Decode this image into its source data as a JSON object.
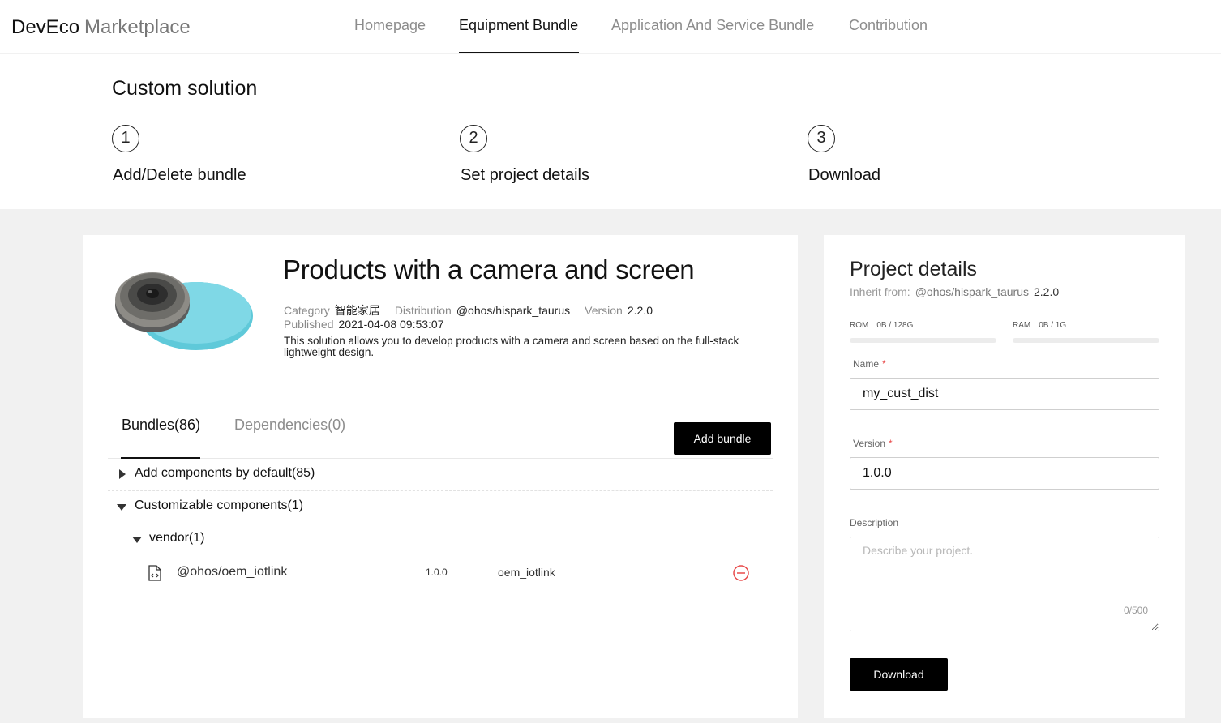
{
  "header": {
    "logo_main": "DevEco",
    "logo_sub": "Marketplace",
    "nav": [
      {
        "label": "Homepage"
      },
      {
        "label": "Equipment Bundle"
      },
      {
        "label": "Application And Service Bundle"
      },
      {
        "label": "Contribution"
      }
    ]
  },
  "steps": {
    "title": "Custom solution",
    "items": [
      {
        "number": "1",
        "label": "Add/Delete bundle"
      },
      {
        "number": "2",
        "label": "Set project details"
      },
      {
        "number": "3",
        "label": "Download"
      }
    ]
  },
  "product": {
    "title": "Products with a camera and screen",
    "category_label": "Category",
    "category_value": "智能家居",
    "distribution_label": "Distribution",
    "distribution_value": "@ohos/hispark_taurus",
    "version_label": "Version",
    "version_value": "2.2.0",
    "published_label": "Published",
    "published_value": "2021-04-08 09:53:07",
    "description": "This solution allows you to develop products with a camera and screen based on the full-stack lightweight design."
  },
  "tabs": {
    "bundles": "Bundles(86)",
    "dependencies": "Dependencies(0)",
    "add_bundle": "Add bundle"
  },
  "tree": {
    "default_group": "Add components by default(85)",
    "custom_group": "Customizable components(1)",
    "vendor_group": "vendor(1)",
    "component": {
      "name": "@ohos/oem_iotlink",
      "version": "1.0.0",
      "id": "oem_iotlink"
    }
  },
  "project": {
    "title": "Project details",
    "inherit_label": "Inherit from:",
    "inherit_value": "@ohos/hispark_taurus",
    "inherit_version": "2.2.0",
    "rom_label": "ROM",
    "rom_value": "0B / 128G",
    "ram_label": "RAM",
    "ram_value": "0B / 1G",
    "name_label": "Name",
    "name_value": "my_cust_dist",
    "version_label": "Version",
    "version_value": "1.0.0",
    "required_mark": "*",
    "description_label": "Description",
    "description_placeholder": "Describe your project.",
    "description_counter": "0/500",
    "download_button": "Download"
  }
}
